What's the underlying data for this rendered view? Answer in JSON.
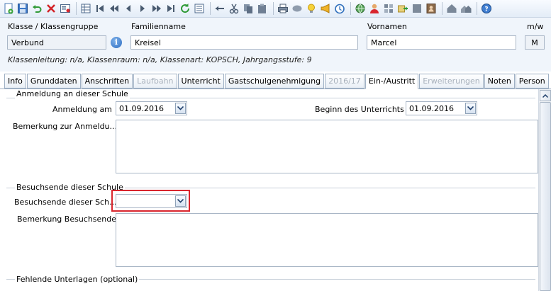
{
  "toolbar": {
    "icons": [
      "new-record-icon",
      "save-icon",
      "undo-icon",
      "delete-icon",
      "form-icon",
      "grid-view-icon",
      "first-icon",
      "previous-page-icon",
      "previous-icon",
      "next-icon",
      "next-page-icon",
      "last-icon",
      "refresh-icon",
      "list-icon",
      "back-arrow-icon",
      "cut-icon",
      "copy-icon",
      "paste-icon",
      "print-icon",
      "oval-icon",
      "lightbulb-icon",
      "megaphone-icon",
      "clock-icon",
      "globe-icon",
      "user-icon",
      "puzzle-icon",
      "export-icon",
      "note-icon",
      "contact-icon",
      "home-icon",
      "homes-icon",
      "help-icon"
    ]
  },
  "header": {
    "klasse_label": "Klasse / Klassengruppe",
    "klasse_value": "Verbund",
    "familienname_label": "Familienname",
    "familienname_value": "Kreisel",
    "vornamen_label": "Vornamen",
    "vornamen_value": "Marcel",
    "geschlecht_label": "m/w",
    "geschlecht_value": "M",
    "info_button": "i",
    "subinfo": "Klassenleitung: n/a, Klassenraum: n/a, Klassenart: KOPSCH, Jahrgangsstufe: 9"
  },
  "tabs": [
    {
      "label": "Info",
      "state": "normal"
    },
    {
      "label": "Grunddaten",
      "state": "normal"
    },
    {
      "label": "Anschriften",
      "state": "normal"
    },
    {
      "label": "Laufbahn",
      "state": "disabled"
    },
    {
      "label": "Unterricht",
      "state": "normal"
    },
    {
      "label": "Gastschulgenehmigung",
      "state": "normal"
    },
    {
      "label": "2016/17",
      "state": "disabled"
    },
    {
      "label": "Ein-/Austritt",
      "state": "active"
    },
    {
      "label": "Erweiterungen",
      "state": "disabled"
    },
    {
      "label": "Noten",
      "state": "normal"
    },
    {
      "label": "Person",
      "state": "normal"
    }
  ],
  "sections": {
    "anmeldung": {
      "title": "Anmeldung an dieser Schule",
      "anmeldung_am_label": "Anmeldung am",
      "anmeldung_am_value": "01.09.2016",
      "beginn_label": "Beginn des Unterrichts",
      "beginn_value": "01.09.2016",
      "bemerkung_label": "Bemerkung zur Anmeldu..."
    },
    "besuchsende": {
      "title": "Besuchsende dieser Schule",
      "besuchsende_label": "Besuchsende dieser Sch...",
      "besuchsende_value": "",
      "bemerkung_label": "Bemerkung Besuchsende"
    },
    "unterlagen": {
      "title": "Fehlende Unterlagen (optional)"
    }
  },
  "colors": {
    "highlight": "#d9262e",
    "toolbar_bg": "#e3ecf7",
    "header_bg": "#f0f5fb"
  }
}
